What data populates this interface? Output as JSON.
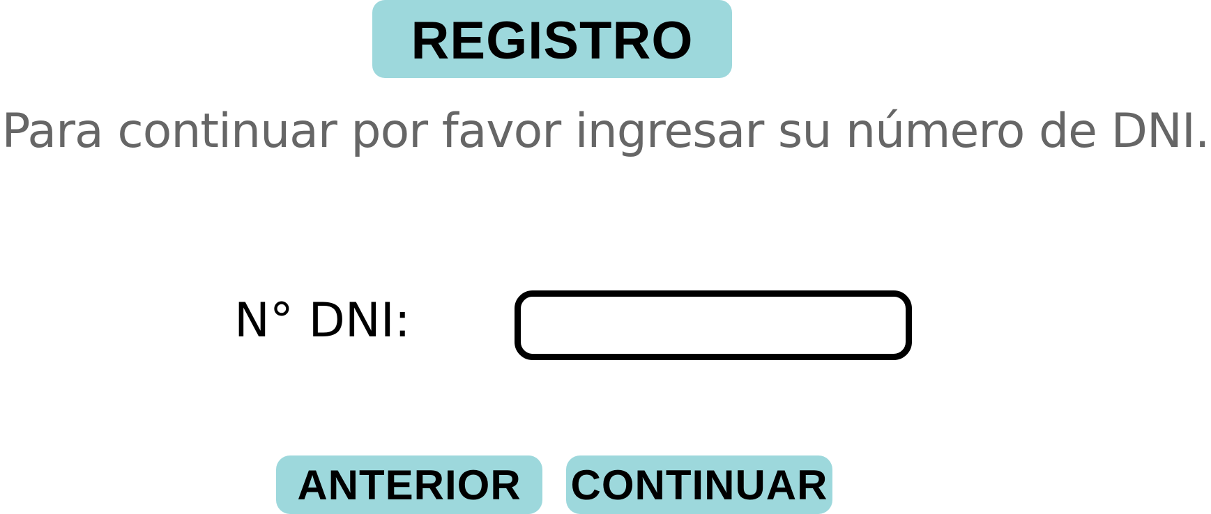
{
  "header": {
    "title": "REGISTRO"
  },
  "main": {
    "instruction": "Para continuar por favor ingresar su número de DNI.",
    "dni": {
      "label": "N° DNI:",
      "value": ""
    }
  },
  "footer": {
    "previous_label": "ANTERIOR",
    "continue_label": "CONTINUAR"
  },
  "colors": {
    "accent": "#9dd8dc",
    "instruction_text": "#666666",
    "text": "#000000",
    "background": "#ffffff"
  }
}
